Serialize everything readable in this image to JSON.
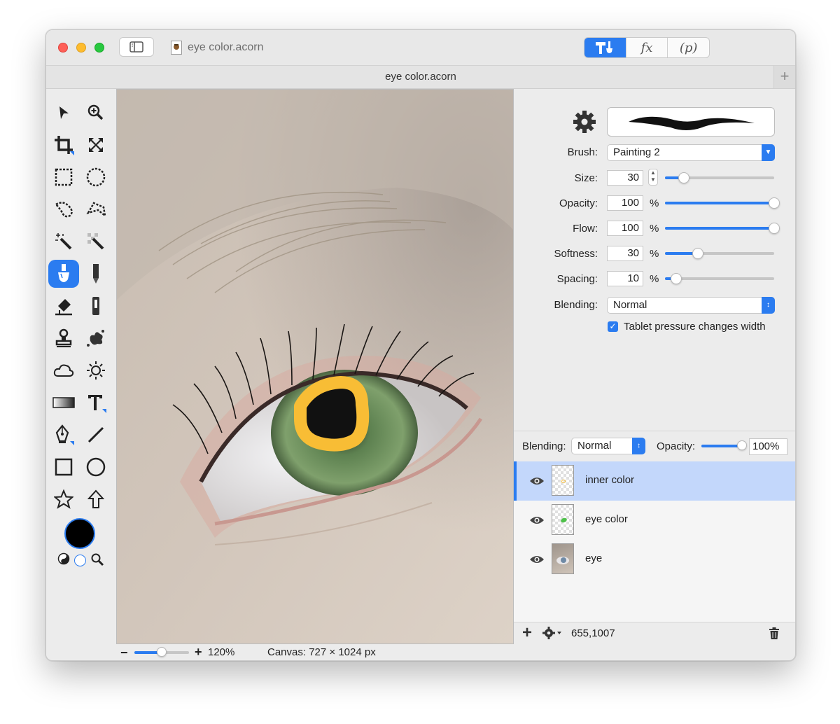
{
  "window": {
    "doc_title": "eye color.acorn",
    "tab_title": "eye color.acorn"
  },
  "modes": {
    "tools": "tools",
    "fx": "fx",
    "p": "(p)"
  },
  "tools": [
    "select-arrow",
    "zoom",
    "crop",
    "transform",
    "rect-select",
    "ellipse-select",
    "lasso",
    "polygon-lasso",
    "magic-wand",
    "instant-alpha",
    "brush",
    "pencil",
    "eraser",
    "gradient-tube",
    "clone",
    "smudge",
    "cloud",
    "sun",
    "gradient",
    "text",
    "pen",
    "line",
    "rectangle",
    "oval",
    "star",
    "arrow"
  ],
  "colors": {
    "accent": "#2b7cf0",
    "foreground": "#000000",
    "background": "#ffffff",
    "highlight": "#c3d7fb"
  },
  "brush": {
    "brush_label": "Brush:",
    "brush_value": "Painting 2",
    "size_label": "Size:",
    "size_value": "30",
    "size_level": 0.17,
    "opacity_label": "Opacity:",
    "opacity_value": "100",
    "opacity_level": 1.0,
    "flow_label": "Flow:",
    "flow_value": "100",
    "flow_level": 1.0,
    "softness_label": "Softness:",
    "softness_value": "30",
    "softness_level": 0.3,
    "spacing_label": "Spacing:",
    "spacing_value": "10",
    "spacing_level": 0.1,
    "percent": "%",
    "blending_label": "Blending:",
    "blending_value": "Normal",
    "tablet_label": "Tablet pressure changes width",
    "tablet_checked": true
  },
  "layers": {
    "blending_label": "Blending:",
    "blending_value": "Normal",
    "opacity_label": "Opacity:",
    "opacity_value": "100%",
    "opacity_level": 1.0,
    "items": [
      {
        "name": "inner color",
        "selected": true
      },
      {
        "name": "eye color",
        "selected": false
      },
      {
        "name": "eye",
        "selected": false
      }
    ],
    "coords": "655,1007"
  },
  "status": {
    "minus": "−",
    "plus": "+",
    "zoom": "120%",
    "canvas": "Canvas: 727 × 1024 px",
    "zoom_level": 0.5
  }
}
